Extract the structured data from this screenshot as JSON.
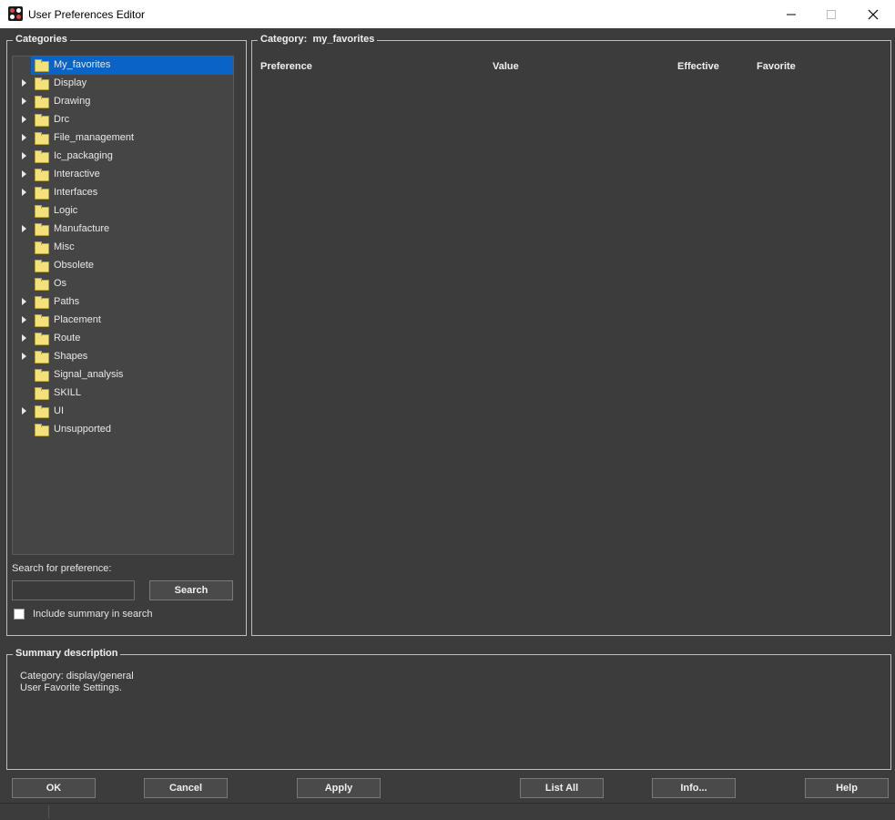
{
  "window": {
    "title": "User Preferences Editor",
    "icons": {
      "app": "app-logo-icon",
      "minimize": "minimize-icon",
      "maximize": "maximize-icon",
      "close": "close-icon"
    }
  },
  "categories": {
    "legend": "Categories",
    "items": [
      {
        "label": "My_favorites",
        "expandable": false,
        "selected": true
      },
      {
        "label": "Display",
        "expandable": true
      },
      {
        "label": "Drawing",
        "expandable": true
      },
      {
        "label": "Drc",
        "expandable": true
      },
      {
        "label": "File_management",
        "expandable": true
      },
      {
        "label": "Ic_packaging",
        "expandable": true
      },
      {
        "label": "Interactive",
        "expandable": true
      },
      {
        "label": "Interfaces",
        "expandable": true
      },
      {
        "label": "Logic",
        "expandable": false
      },
      {
        "label": "Manufacture",
        "expandable": true
      },
      {
        "label": "Misc",
        "expandable": false
      },
      {
        "label": "Obsolete",
        "expandable": false
      },
      {
        "label": "Os",
        "expandable": false
      },
      {
        "label": "Paths",
        "expandable": true
      },
      {
        "label": "Placement",
        "expandable": true
      },
      {
        "label": "Route",
        "expandable": true
      },
      {
        "label": "Shapes",
        "expandable": true
      },
      {
        "label": "Signal_analysis",
        "expandable": false
      },
      {
        "label": "SKILL",
        "expandable": false
      },
      {
        "label": "UI",
        "expandable": true
      },
      {
        "label": "Unsupported",
        "expandable": false
      }
    ],
    "search_label": "Search for preference:",
    "search_value": "",
    "search_button": "Search",
    "include_summary_label": "Include summary in search",
    "include_summary_checked": false
  },
  "category_panel": {
    "legend_prefix": "Category:",
    "legend_value": "my_favorites",
    "columns": [
      "Preference",
      "Value",
      "Effective",
      "Favorite"
    ]
  },
  "summary": {
    "legend": "Summary description",
    "line1": "Category: display/general",
    "line2": "User Favorite Settings."
  },
  "buttons": {
    "ok": "OK",
    "cancel": "Cancel",
    "apply": "Apply",
    "list_all": "List All",
    "info": "Info...",
    "help": "Help"
  },
  "colors": {
    "background": "#3c3c3c",
    "selection": "#0a64c8",
    "folder": "#f3e27a"
  }
}
